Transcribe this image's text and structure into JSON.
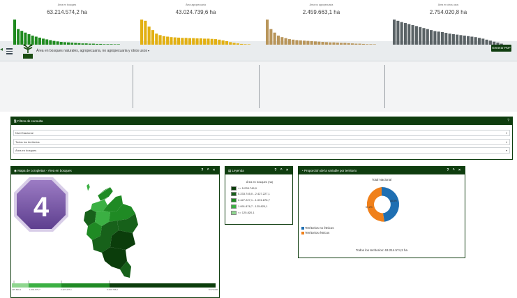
{
  "topbar": {
    "title": "Área en bosques naturales, agropecuaria, no agropecuaria y otros usos",
    "pdf_button": "Generar PDF"
  },
  "stats": [
    {
      "caption": "Área en bosques",
      "value": "63.214.574,2 ha",
      "color": "#1e8a1e",
      "bars": [
        100,
        62,
        55,
        48,
        42,
        36,
        32,
        28,
        24,
        21,
        18,
        15,
        13,
        11,
        10,
        9,
        8,
        7,
        6,
        5,
        5,
        4,
        4,
        3,
        3,
        2,
        2,
        2,
        1,
        1
      ]
    },
    {
      "caption": "Área agropecuaria",
      "value": "43.024.739,6 ha",
      "color": "#e2b012",
      "bars": [
        100,
        95,
        72,
        58,
        44,
        38,
        34,
        32,
        30,
        29,
        28,
        27,
        27,
        26,
        26,
        25,
        25,
        24,
        24,
        23,
        22,
        20,
        17,
        14,
        10,
        7,
        5,
        3,
        2,
        1
      ]
    },
    {
      "caption": "Área no agropecuaria",
      "value": "2.459.663,1 ha",
      "color": "#b8955a",
      "bars": [
        100,
        62,
        48,
        36,
        30,
        26,
        22,
        20,
        18,
        17,
        16,
        15,
        14,
        13,
        12,
        11,
        10,
        9,
        9,
        8,
        7,
        7,
        6,
        5,
        4,
        4,
        3,
        2,
        2,
        1
      ]
    },
    {
      "caption": "Área en otros usos",
      "value": "2.754.020,8 ha",
      "color": "#5b6366",
      "bars": [
        100,
        95,
        90,
        86,
        82,
        78,
        74,
        70,
        66,
        62,
        58,
        54,
        52,
        50,
        47,
        44,
        42,
        40,
        38,
        36,
        34,
        32,
        30,
        27,
        24,
        20,
        16,
        12,
        8,
        4
      ]
    }
  ],
  "filters": {
    "title": "Filtros de consulta",
    "help": "?",
    "selects": [
      "Nivel Nacional",
      "Todos los territorios",
      "Área en bosques"
    ]
  },
  "map_panel": {
    "title": "Mapa de coropletas - Área en bosques",
    "controls": "? ^ ×",
    "badge": "4",
    "scale_labels": [
      "125.820,1",
      "1.091.876,7",
      "2.427.227,1",
      "5.233.745,0",
      "8.970.000"
    ]
  },
  "legend_panel": {
    "title": "Leyenda",
    "controls": "? ^ ×",
    "subtitle": "Área en bosques (ha)",
    "items": [
      {
        "label": ">= 5.233.745,0",
        "color": "#0b3d0b"
      },
      {
        "label": "5.233.745,0 - 2.427.227,1",
        "color": "#17611a"
      },
      {
        "label": "2.427.227,1 - 1.091.876,7",
        "color": "#1f8a24"
      },
      {
        "label": "1.091.876,7 - 125.820,1",
        "color": "#3bb043"
      },
      {
        "label": "<= 125.820,1",
        "color": "#8fd68f"
      }
    ]
  },
  "prop_panel": {
    "title": "Proporción de la variable por territorio",
    "controls": "? ^ ×",
    "chart_title": "Total Nacional",
    "label_blue": "48,8%",
    "label_orange": "51,2%",
    "legend": [
      {
        "label": "Territorios no étnicos",
        "color": "#1f6fb2"
      },
      {
        "label": "Territorios étnicos",
        "color": "#f0801a"
      }
    ],
    "total": "Todos los territorios: 63.214.574,2 ha"
  }
}
